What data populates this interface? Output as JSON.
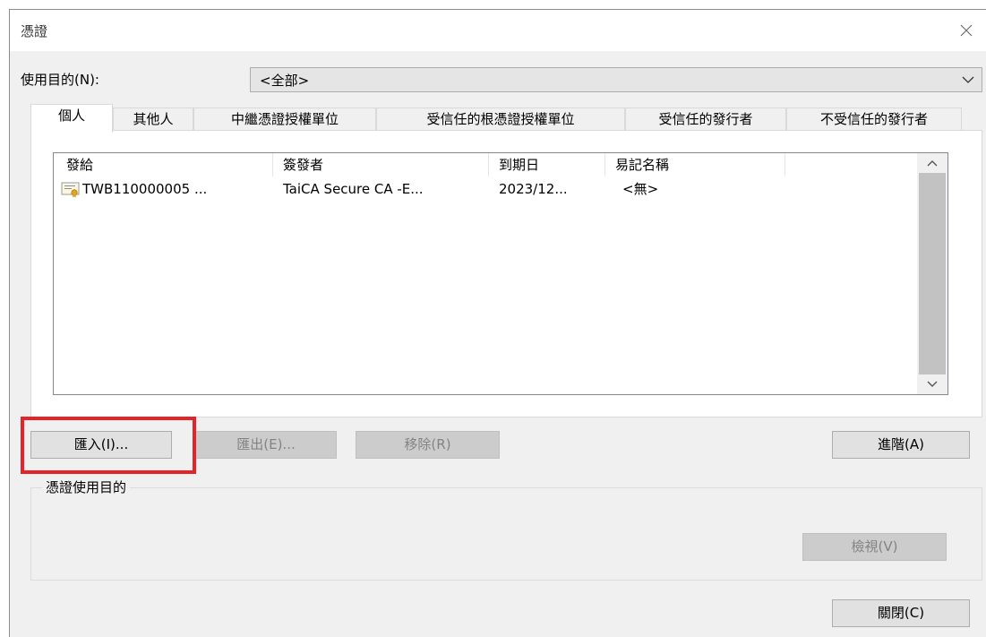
{
  "window": {
    "title": "憑證"
  },
  "purpose": {
    "label": "使用目的(N):",
    "value": "<全部>"
  },
  "tabs": [
    {
      "label": "個人"
    },
    {
      "label": "其他人"
    },
    {
      "label": "中繼憑證授權單位"
    },
    {
      "label": "受信任的根憑證授權單位"
    },
    {
      "label": "受信任的發行者"
    },
    {
      "label": "不受信任的發行者"
    }
  ],
  "columns": [
    {
      "label": "發給"
    },
    {
      "label": "簽發者"
    },
    {
      "label": "到期日"
    },
    {
      "label": "易記名稱"
    }
  ],
  "rows": [
    {
      "issued_to": "TWB110000005 ...",
      "issuer": "TaiCA Secure CA -E...",
      "expires": "2023/12...",
      "friendly_name": "<無>",
      "icon": "certificate-icon"
    }
  ],
  "buttons": {
    "import": "匯入(I)...",
    "export": "匯出(E)...",
    "remove": "移除(R)",
    "advanced": "進階(A)",
    "view": "檢視(V)",
    "close": "關閉(C)"
  },
  "purpose_group": {
    "label": "憑證使用目的"
  },
  "colors": {
    "highlight": "#e3252a",
    "dialog_bg": "#f0f0f0",
    "disabled_text": "#838383"
  }
}
